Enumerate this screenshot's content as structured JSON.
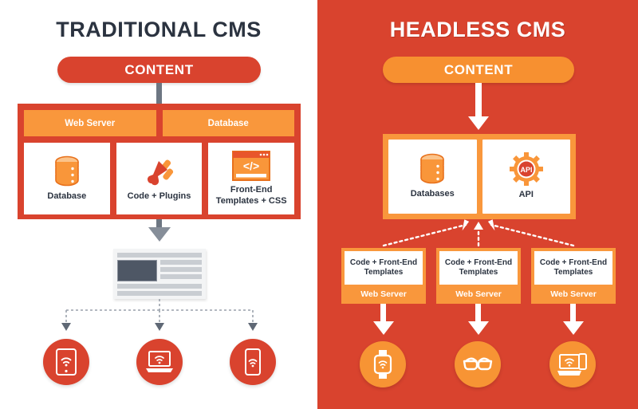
{
  "colors": {
    "red": "#d9432e",
    "orange": "#f9973c",
    "orange_alt": "#f79030",
    "white": "#ffffff",
    "dark_text": "#2b3340",
    "gray_connector": "#6d7682",
    "gray_arrow": "#868e99"
  },
  "left": {
    "title": "TRADITIONAL CMS",
    "content_label": "CONTENT",
    "stack_top": [
      {
        "label": "Web Server"
      },
      {
        "label": "Database"
      }
    ],
    "stack_bottom": [
      {
        "label": "Database",
        "icon": "database-icon"
      },
      {
        "label": "Code + Plugins",
        "icon": "plug-icon"
      },
      {
        "label": "Front-End Templates + CSS",
        "icon": "code-window-icon"
      }
    ],
    "output": {
      "name": "webpage-mockup"
    },
    "devices": [
      {
        "label": "tablet",
        "icon": "tablet-wifi-icon"
      },
      {
        "label": "laptop",
        "icon": "laptop-wifi-icon"
      },
      {
        "label": "phone",
        "icon": "phone-wifi-icon"
      }
    ]
  },
  "right": {
    "title": "HEADLESS CMS",
    "content_label": "CONTENT",
    "core": [
      {
        "label": "Databases",
        "icon": "database-icon"
      },
      {
        "label": "API",
        "icon": "api-gear-icon",
        "badge": "API"
      }
    ],
    "web_servers": [
      {
        "top_label": "Code + Front-End Templates",
        "foot_label": "Web Server"
      },
      {
        "top_label": "Code + Front-End Templates",
        "foot_label": "Web Server"
      },
      {
        "top_label": "Code + Front-End Templates",
        "foot_label": "Web Server"
      }
    ],
    "devices": [
      {
        "label": "smartwatch",
        "icon": "smartwatch-wifi-icon"
      },
      {
        "label": "smart-glasses",
        "icon": "smart-glasses-icon"
      },
      {
        "label": "laptop-phone",
        "icon": "laptop-phone-wifi-icon"
      }
    ]
  }
}
